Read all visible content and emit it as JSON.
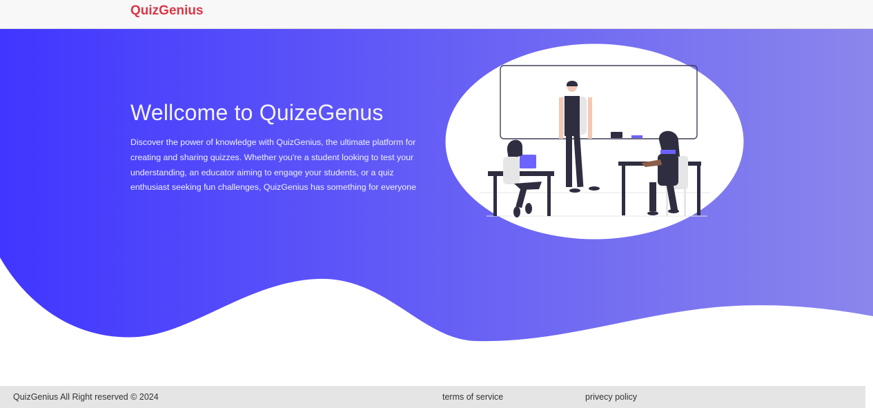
{
  "navbar": {
    "brand": "QuizGenius"
  },
  "hero": {
    "title": "Wellcome to QuizeGenus",
    "description": "Discover the power of knowledge with QuizGenius, the ultimate platform for creating and sharing quizzes. Whether you're a student looking to test your understanding, an educator aiming to engage your students, or a quiz enthusiast seeking fun challenges, QuizGenius has something for everyone",
    "gradient_start": "#4036ff",
    "gradient_end": "#8b86ec",
    "illustration": "classroom-illustration"
  },
  "footer": {
    "copyright": "QuizGenius All Right reserved © 2024",
    "terms_label": "terms of service",
    "privacy_label": "privecy policy"
  },
  "colors": {
    "brand": "#dc3545",
    "navbar_bg": "#f8f8f8",
    "footer_bg": "#e5e5e5"
  }
}
